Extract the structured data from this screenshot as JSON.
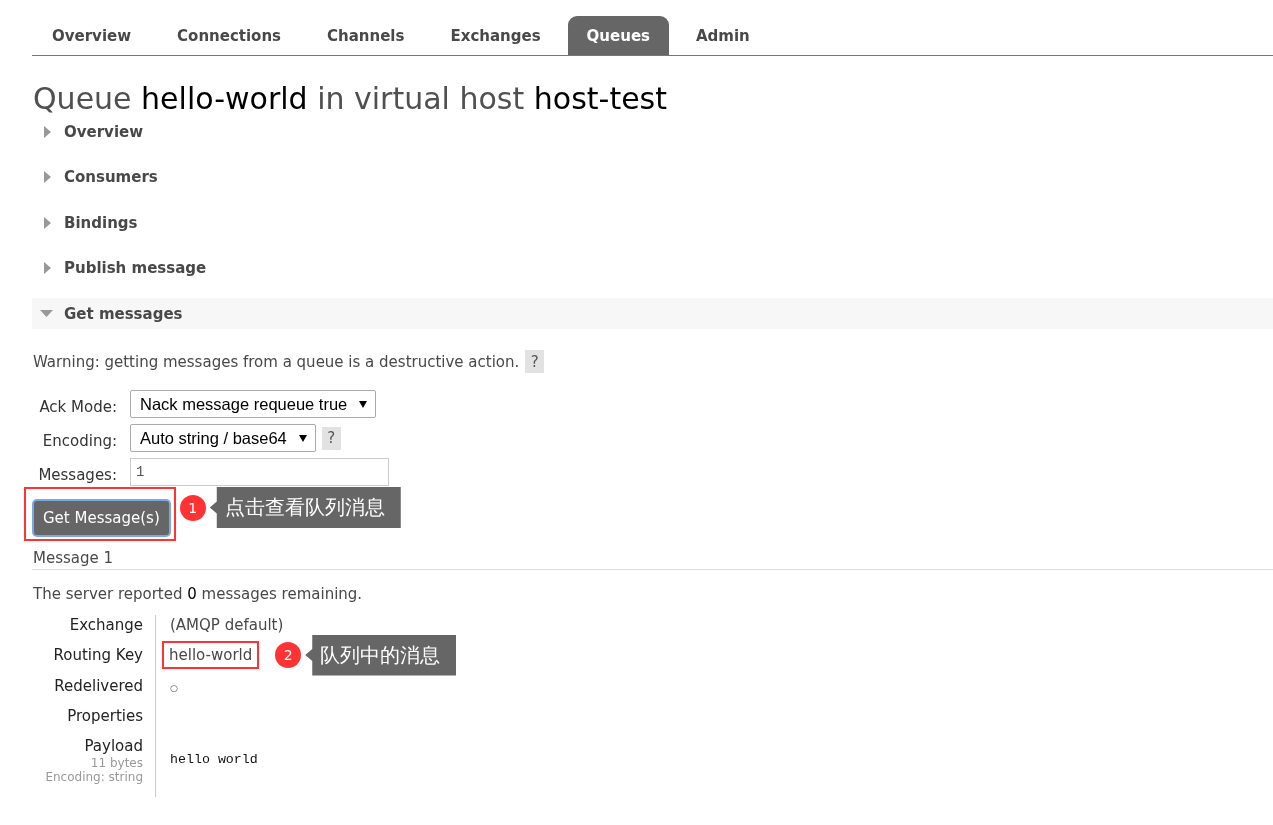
{
  "tabs": [
    {
      "label": "Overview",
      "selected": false
    },
    {
      "label": "Connections",
      "selected": false
    },
    {
      "label": "Channels",
      "selected": false
    },
    {
      "label": "Exchanges",
      "selected": false
    },
    {
      "label": "Queues",
      "selected": true
    },
    {
      "label": "Admin",
      "selected": false
    }
  ],
  "title": {
    "lead": "Queue",
    "queue": "hello-world",
    "middle": "in virtual host",
    "vhost": "host-test"
  },
  "sections": [
    {
      "title": "Overview",
      "expanded": false
    },
    {
      "title": "Consumers",
      "expanded": false
    },
    {
      "title": "Bindings",
      "expanded": false
    },
    {
      "title": "Publish message",
      "expanded": false
    },
    {
      "title": "Get messages",
      "expanded": true
    }
  ],
  "get_messages": {
    "warning": "Warning: getting messages from a queue is a destructive action.",
    "warning_help": "?",
    "fields": [
      {
        "kind": "select",
        "label": "Ack Mode:",
        "value": "Nack message requeue true"
      },
      {
        "kind": "select",
        "label": "Encoding:",
        "value": "Auto string / base64",
        "help": "?"
      },
      {
        "kind": "input",
        "label": "Messages:",
        "value": "1"
      }
    ],
    "button": {
      "label": "Get Message(s)",
      "annotation": {
        "number": "1",
        "text": "点击查看队列消息"
      }
    }
  },
  "message": {
    "heading": "Message 1",
    "report": {
      "before": "The server reported",
      "count": "0",
      "after": "messages remaining."
    },
    "rows": [
      {
        "label": "Exchange",
        "kind": "text",
        "value": "(AMQP default)"
      },
      {
        "label": "Routing Key",
        "kind": "text",
        "value": "hello-world",
        "annotation": {
          "number": "2",
          "text": "队列中的消息"
        }
      },
      {
        "label": "Redelivered",
        "kind": "symbol",
        "value": "○"
      },
      {
        "label": "Properties",
        "kind": "text"
      },
      {
        "label": "Payload",
        "kind": "code",
        "notes": [
          "11 bytes",
          "Encoding: string"
        ],
        "value": "hello world"
      }
    ]
  }
}
